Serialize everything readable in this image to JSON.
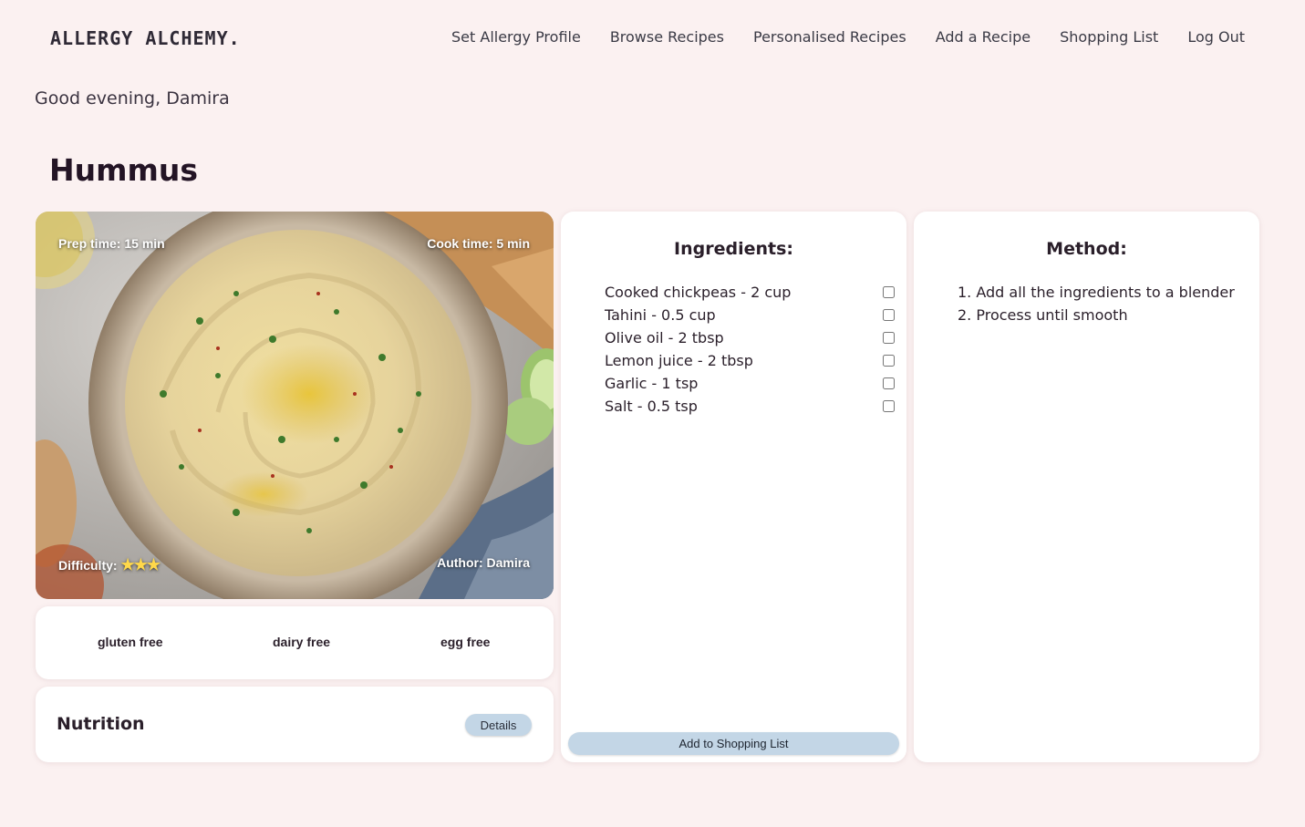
{
  "brand": {
    "logo": "ALLERGY ALCHEMY."
  },
  "nav": {
    "items": [
      "Set Allergy Profile",
      "Browse Recipes",
      "Personalised Recipes",
      "Add a Recipe",
      "Shopping List",
      "Log Out"
    ]
  },
  "greeting": "Good evening, Damira",
  "recipe": {
    "title": "Hummus",
    "prep_time": "Prep time: 15 min",
    "cook_time": "Cook time: 5 min",
    "difficulty_label": "Difficulty:",
    "difficulty_stars": "★★★",
    "difficulty_level": 3,
    "author": "Author: Damira"
  },
  "tags": [
    "gluten free",
    "dairy free",
    "egg free"
  ],
  "nutrition": {
    "title": "Nutrition",
    "details_label": "Details"
  },
  "ingredients": {
    "title": "Ingredients:",
    "items": [
      "Cooked chickpeas - 2 cup",
      "Tahini - 0.5 cup",
      "Olive oil - 2 tbsp",
      "Lemon juice - 2 tbsp",
      "Garlic - 1 tsp",
      "Salt - 0.5 tsp"
    ],
    "add_button": "Add to Shopping List"
  },
  "method": {
    "title": "Method:",
    "steps": [
      "1. Add all the ingredients to a blender",
      "2. Process until smooth"
    ]
  },
  "colors": {
    "background": "#fbf1f1",
    "button": "#c3d6e6",
    "text": "#2a1f2a"
  }
}
